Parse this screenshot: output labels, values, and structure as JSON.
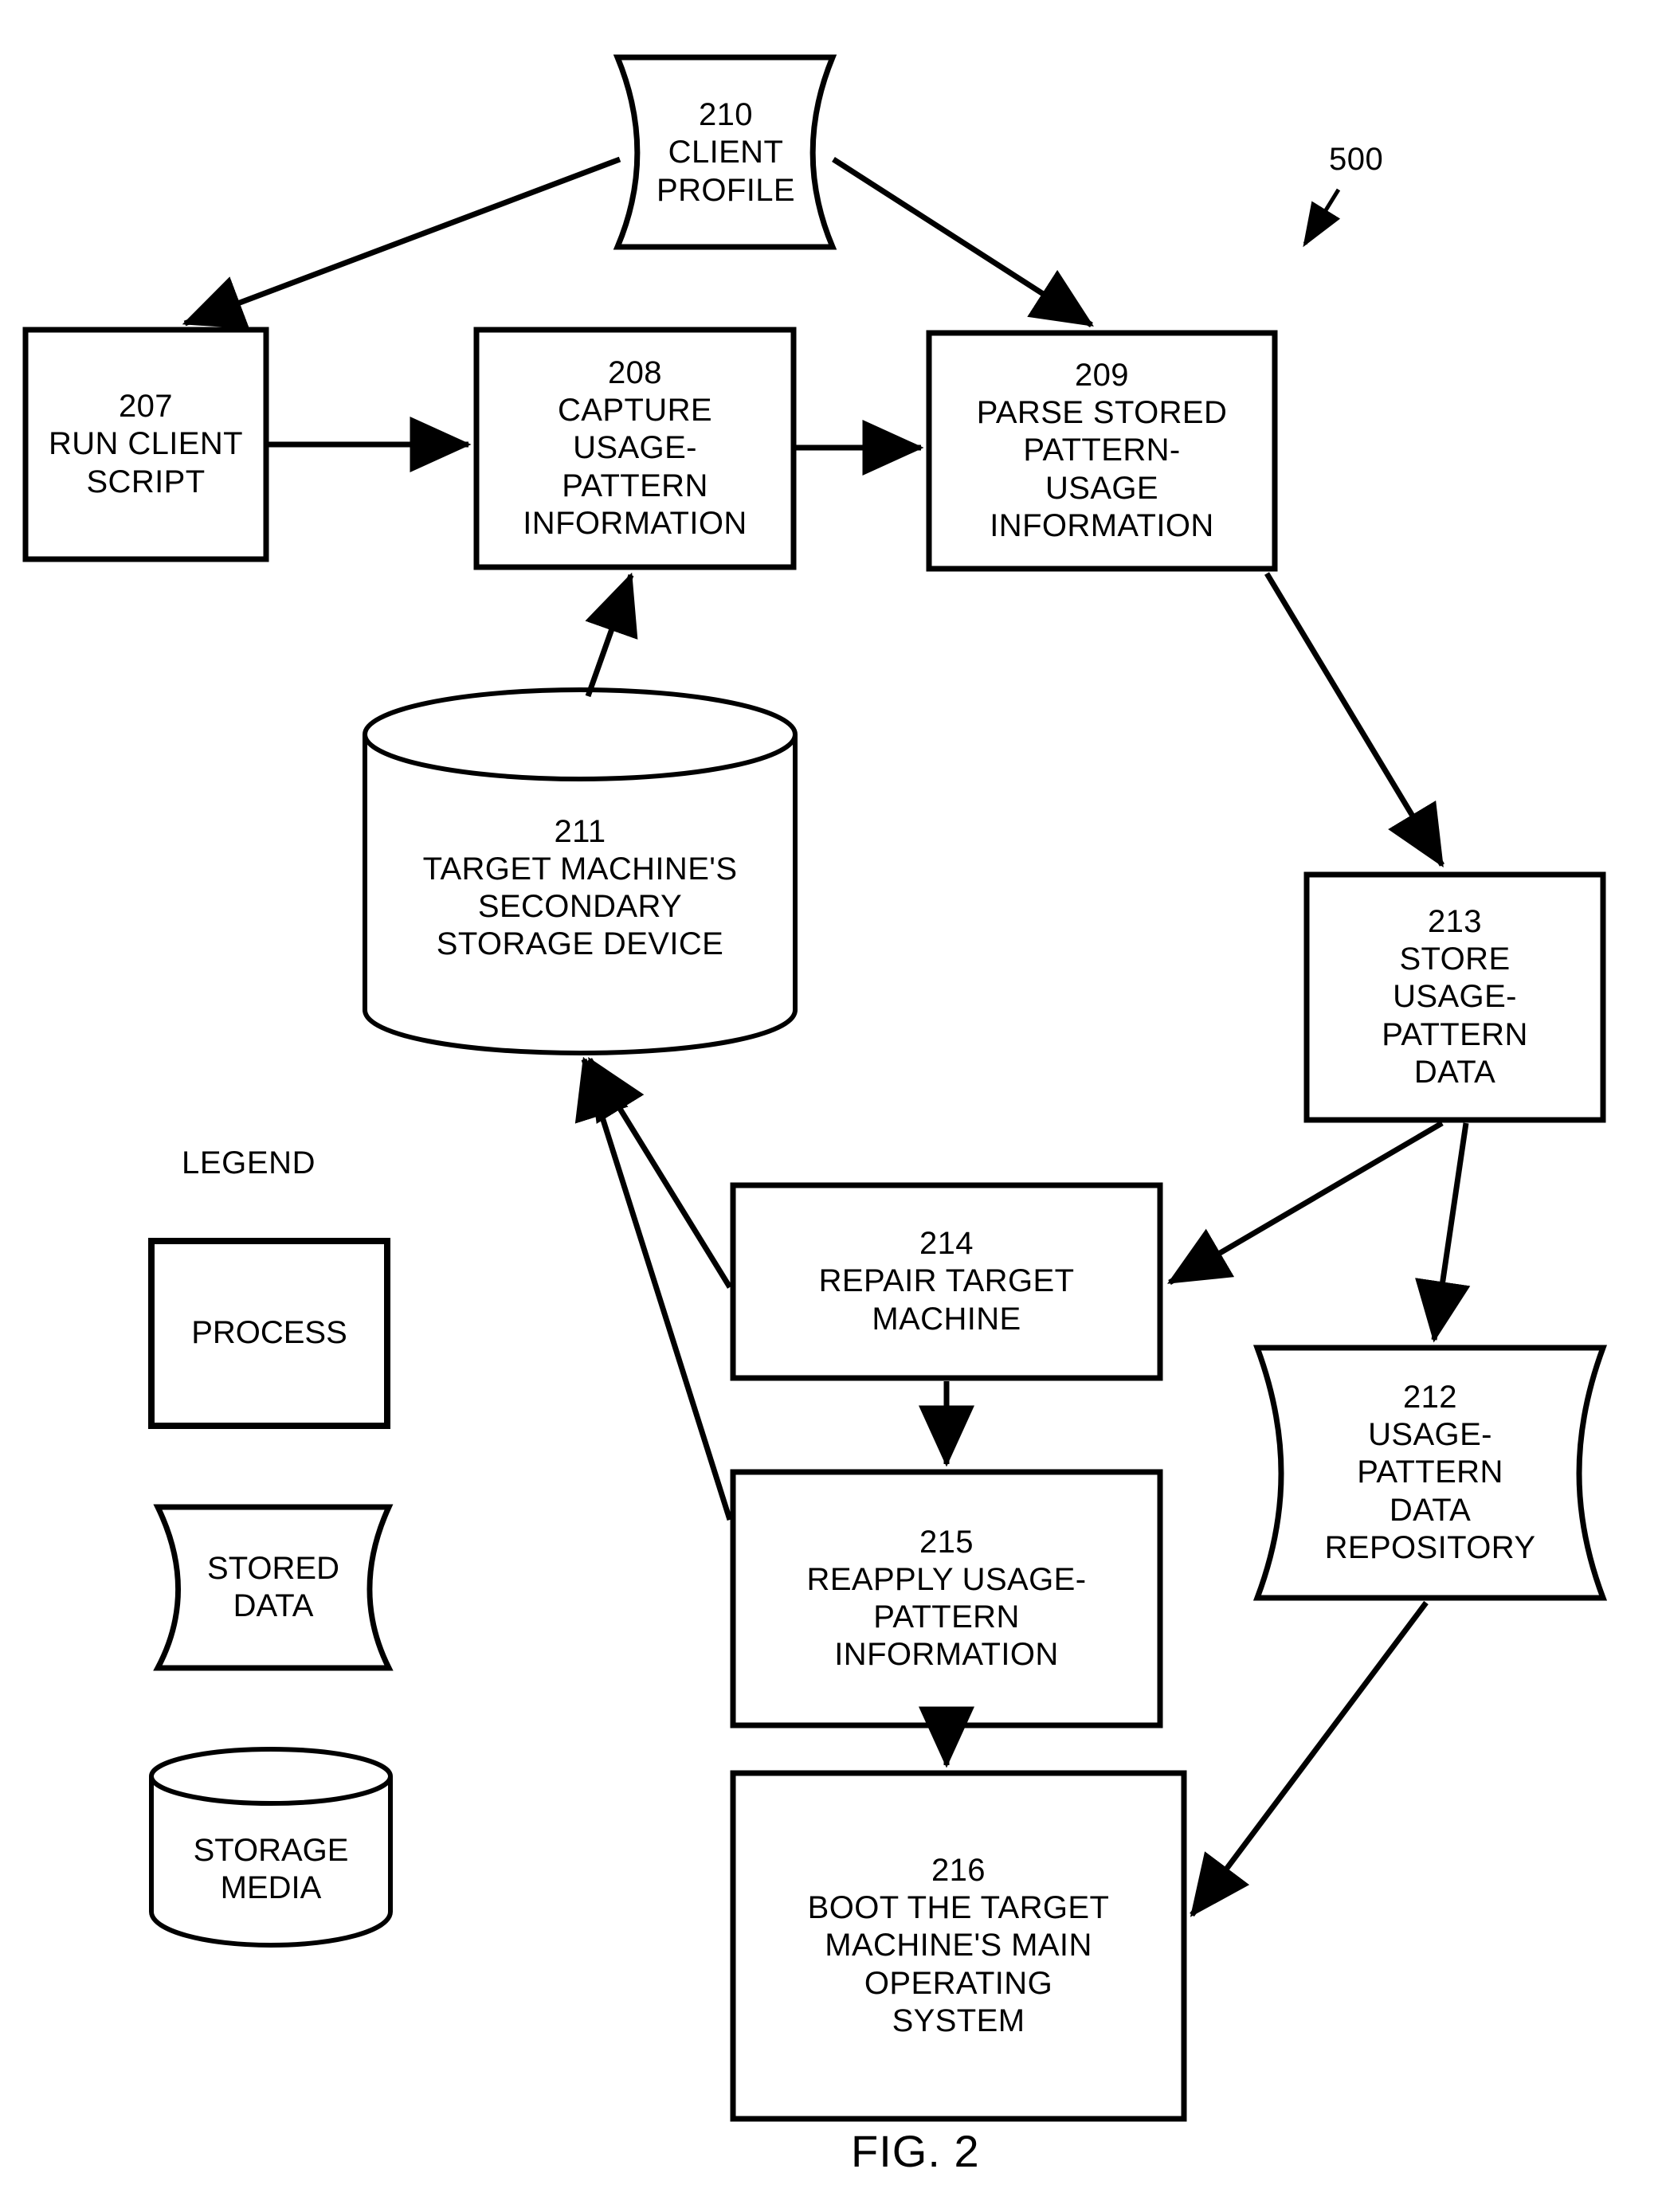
{
  "figure": {
    "caption": "FIG. 2",
    "system_ref": "500"
  },
  "nodes": {
    "n210": {
      "ref": "210",
      "label": "CLIENT\nPROFILE",
      "shape": "stored-data"
    },
    "n207": {
      "ref": "207",
      "label": "RUN CLIENT\nSCRIPT",
      "shape": "process"
    },
    "n208": {
      "ref": "208",
      "label": "CAPTURE\nUSAGE-\nPATTERN\nINFORMATION",
      "shape": "process"
    },
    "n209": {
      "ref": "209",
      "label": "PARSE STORED\nPATTERN-\nUSAGE\nINFORMATION",
      "shape": "process"
    },
    "n211": {
      "ref": "211",
      "label": "TARGET MACHINE'S\nSECONDARY\nSTORAGE DEVICE",
      "shape": "storage-media"
    },
    "n213": {
      "ref": "213",
      "label": "STORE\nUSAGE-\nPATTERN\nDATA",
      "shape": "process"
    },
    "n214": {
      "ref": "214",
      "label": "REPAIR TARGET\nMACHINE",
      "shape": "process"
    },
    "n215": {
      "ref": "215",
      "label": "REAPPLY USAGE-\nPATTERN\nINFORMATION",
      "shape": "process"
    },
    "n216": {
      "ref": "216",
      "label": "BOOT THE TARGET\nMACHINE'S MAIN\nOPERATING\nSYSTEM",
      "shape": "process"
    },
    "n212": {
      "ref": "212",
      "label": "USAGE-\nPATTERN\nDATA\nREPOSITORY",
      "shape": "stored-data"
    }
  },
  "legend": {
    "title": "LEGEND",
    "items": [
      {
        "key": "process",
        "label": "PROCESS"
      },
      {
        "key": "stored-data",
        "label": "STORED\nDATA"
      },
      {
        "key": "storage-media",
        "label": "STORAGE\nMEDIA"
      }
    ]
  },
  "edges": [
    {
      "from": "210",
      "to": "207"
    },
    {
      "from": "210",
      "to": "209"
    },
    {
      "from": "207",
      "to": "208"
    },
    {
      "from": "208",
      "to": "209"
    },
    {
      "from": "211",
      "to": "208"
    },
    {
      "from": "209",
      "to": "213"
    },
    {
      "from": "213",
      "to": "214"
    },
    {
      "from": "213",
      "to": "212"
    },
    {
      "from": "214",
      "to": "211"
    },
    {
      "from": "214",
      "to": "215"
    },
    {
      "from": "215",
      "to": "211"
    },
    {
      "from": "215",
      "to": "216"
    },
    {
      "from": "212",
      "to": "216"
    }
  ],
  "colors": {
    "stroke": "#000000",
    "background": "#ffffff"
  }
}
